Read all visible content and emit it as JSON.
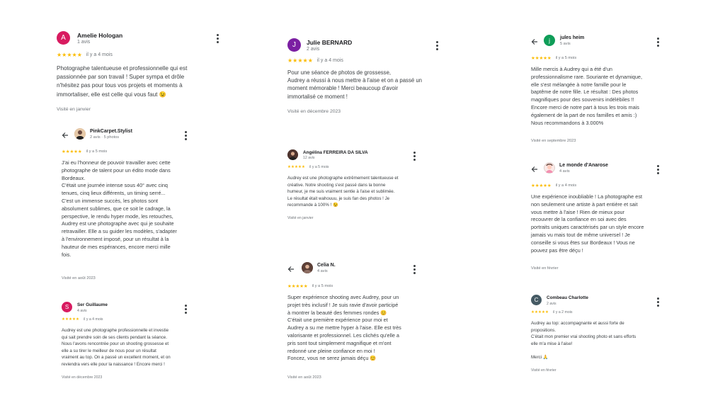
{
  "reviews": {
    "amelie": {
      "initial": "A",
      "name": "Amelie Hologan",
      "count": "1 avis",
      "stars": "★★★★★",
      "when": "il y a 4 mois",
      "text": "Photographe talentueuse et professionnelle qui est\npassionnée par son travail ! Super sympa et drôle\nn'hésitez pas pour tous vos projets et moments à\nimmortaliser, elle est celle qui vous faut 😉",
      "visited": "Visité en janvier"
    },
    "pinkcarpet": {
      "name": "PinkCarpet.Stylist",
      "count": "2 avis · 5 photos",
      "stars": "★★★★★",
      "when": "il y a 5 mois",
      "text": "J'ai eu l'honneur de pouvoir travailler avec cette\nphotographe de talent pour un édito mode dans\nBordeaux.\nC'était une journée intense sous 40° avec cinq\ntenues, cinq lieux différents, un timing serré...\nC'est un immense succès, les photos sont\nabsolument sublimes, que ce soit le cadrage, la\nperspective, le rendu hyper mode, les retouches,\nAudrey est une photographe avec qui je souhaite\nretravailler. Elle a su guider les modèles, s'adapter\nà l'environnement imposé, pour un résultat à la\nhauteur de mes espérances, encore merci mille\nfois.",
      "visited": "Visité en août 2023"
    },
    "ser": {
      "initial": "S",
      "name": "Ser Guillaume",
      "count": "4 avis",
      "stars": "★★★★★",
      "when": "il y a 4 mois",
      "text": "Audrey est une photographe professionnelle et investie\nqui sait prendre soin de ses clients pendant la séance.\nNous l'avons rencontrée pour un shooting grossesse et\nelle a su tirer le meilleur de nous pour un résultat\nvraiment au top. On a passé un excellent moment, et on\nreviendra vers elle pour la naissance ! Encore merci !",
      "visited": "Visité en décembre 2023"
    },
    "julie": {
      "initial": "J",
      "name": "Julie BERNARD",
      "count": "2 avis",
      "stars": "★★★★★",
      "when": "il y a 4 mois",
      "text": "Pour une séance de photos de grossesse,\nAudrey a réussi à nous mettre à l'aise et on a passé un\nmoment mémorable ! Merci beaucoup d'avoir\nimmortalisé ce moment !",
      "visited": "Visité en décembre 2023"
    },
    "angelina": {
      "name": "Angélina FERREIRA DA SILVA",
      "count": "12 avis",
      "stars": "★★★★★",
      "when": "il y a 5 mois",
      "text": "Audrey est une photographe extrêmement talentueuse et\ncréative. Notre shooting s'est passé dans la bonne\nhumeur, je me suis vraiment sentie à l'aise et sublimée.\nLe résultat était wahouuu, je suis fan des photos ! Je\nrecommande à 100% ! 😉",
      "visited": "Visité en janvier"
    },
    "celia": {
      "name": "Celia N.",
      "count": "4 avis",
      "stars": "★★★★★",
      "when": "il y a 5 mois",
      "text": "Super expérience shooting avec Audrey, pour un\nprojet très inclusif ! Je suis ravie d'avoir participé\nà montrer la beauté des femmes rondes 😊\nC'était une première expérience pour moi et\nAudrey a su me mettre hyper à l'aise. Elle est très\nvalorisante et professionnel. Les clichés qu'elle a\npris sont tout simplement magnifique et m'ont\nredonné une pleine confiance en moi !\nFoncez, vous ne serez jamais déçu 😊",
      "visited": "Visité en août 2023"
    },
    "jules": {
      "initial": "j",
      "name": "jules heim",
      "count": "5 avis",
      "stars": "★★★★★",
      "when": "il y a 5 mois",
      "text": "Mille mercis à Audrey qui a été d'un\nprofessionnalisme rare. Souriante et dynamique,\nelle s'est mélangée à notre famille pour le\nbaptême de notre fille. Le résultat : Des photos\nmagnifiques pour des souvenirs indélébiles !!\nEncore merci de notre part à tous les trois mais\négalement de la part de nos familles et amis :)\nNous recommandons à 3.000%",
      "visited": "Visité en septembre 2023"
    },
    "anarose": {
      "name": "Le monde d'Anarose",
      "count": "4 avis",
      "stars": "★★★★★",
      "when": "il y a 4 mois",
      "text": "Une expérience inoubliable ! La photographe est\nnon seulement une artiste à part entière et sait\nvous mettre à l'aise ! Rien de mieux pour\nrecouvrer de la confiance en soi avec des\nportraits uniques caractérisés par un style encore\njamais vu mais tout de même universel ! Je\nconseille si vous êtes sur Bordeaux ! Vous ne\npouvez pas être déçu !",
      "visited": "Visité en février"
    },
    "combeau": {
      "initial": "C",
      "name": "Combeau Charlotte",
      "count": "2 avis",
      "stars": "★★★★★",
      "when": "il y a 2 mois",
      "text": "Audrey au top: accompagnante et aussi forte de\npropositions.\nC'était mon premier vrai shooting photo et sans efforts\nelle m'a mise à l'aise!\n\nMerci 🙏",
      "visited": "Visité en février"
    }
  },
  "colors": {
    "amelie": "#d81b60",
    "ser": "#d81b60",
    "julie": "#7b1fa2",
    "jules": "#0f9d58",
    "combeau": "#455a64",
    "stars": "#fbbc04"
  },
  "icons": [
    "back-arrow-icon",
    "more-vert-icon",
    "star-icon"
  ]
}
